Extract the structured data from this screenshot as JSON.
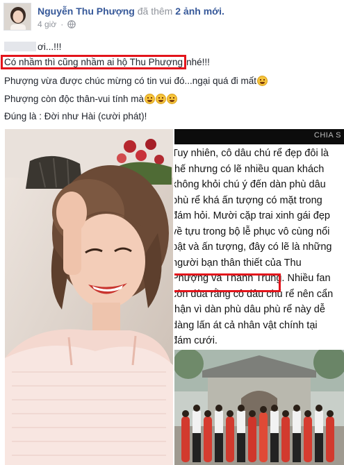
{
  "post": {
    "author_name": "Nguyễn Thu Phượng",
    "action_text": "đã thêm",
    "photo_count_text": "2 ảnh mới.",
    "timestamp": "4 giờ",
    "separator": "·",
    "privacy_icon": "globe-icon"
  },
  "body": {
    "line1_text": "ơi...!!!",
    "line2_highlight": "Có nhầm thì cũng nhầm ai hộ Thu Phượng",
    "line2_rest": "nhé!!!",
    "line3_text": "Phượng vừa được chúc mừng có tin vui đó...ngại quá đi mất",
    "line4_text": "Phượng còn độc thân-vui tính mà",
    "line5_text": "Đúng là : Đời như Hài (cười phát)!"
  },
  "photo_right": {
    "share_label": "CHIA S",
    "article_lines": [
      "Tuy nhiên, cô dâu chú rể đẹp đôi là",
      "thế nhưng có lẽ nhiều quan khách",
      "không khỏi chú ý đến dàn phù dâu",
      "phù rể khá ấn tượng có mặt trong",
      "đám hỏi. Mười cặp trai xinh gái đẹp",
      "về tựu trong bộ lễ phục vô cùng nổi",
      "bật và ấn tượng, đây có lẽ là những",
      "người bạn thân thiết của Thu",
      "Phượng và Thành Trung. Nhiều fan",
      "còn đùa rằng cô dâu chú rể nên cẩn",
      "thận vì dàn phù dâu phù rể này dễ",
      "dàng lấn át cả nhân vật chính tại",
      "đám cưới."
    ]
  },
  "colors": {
    "link": "#365899",
    "meta": "#90949c",
    "text": "#1d2129",
    "highlight_box": "#e3141b"
  }
}
